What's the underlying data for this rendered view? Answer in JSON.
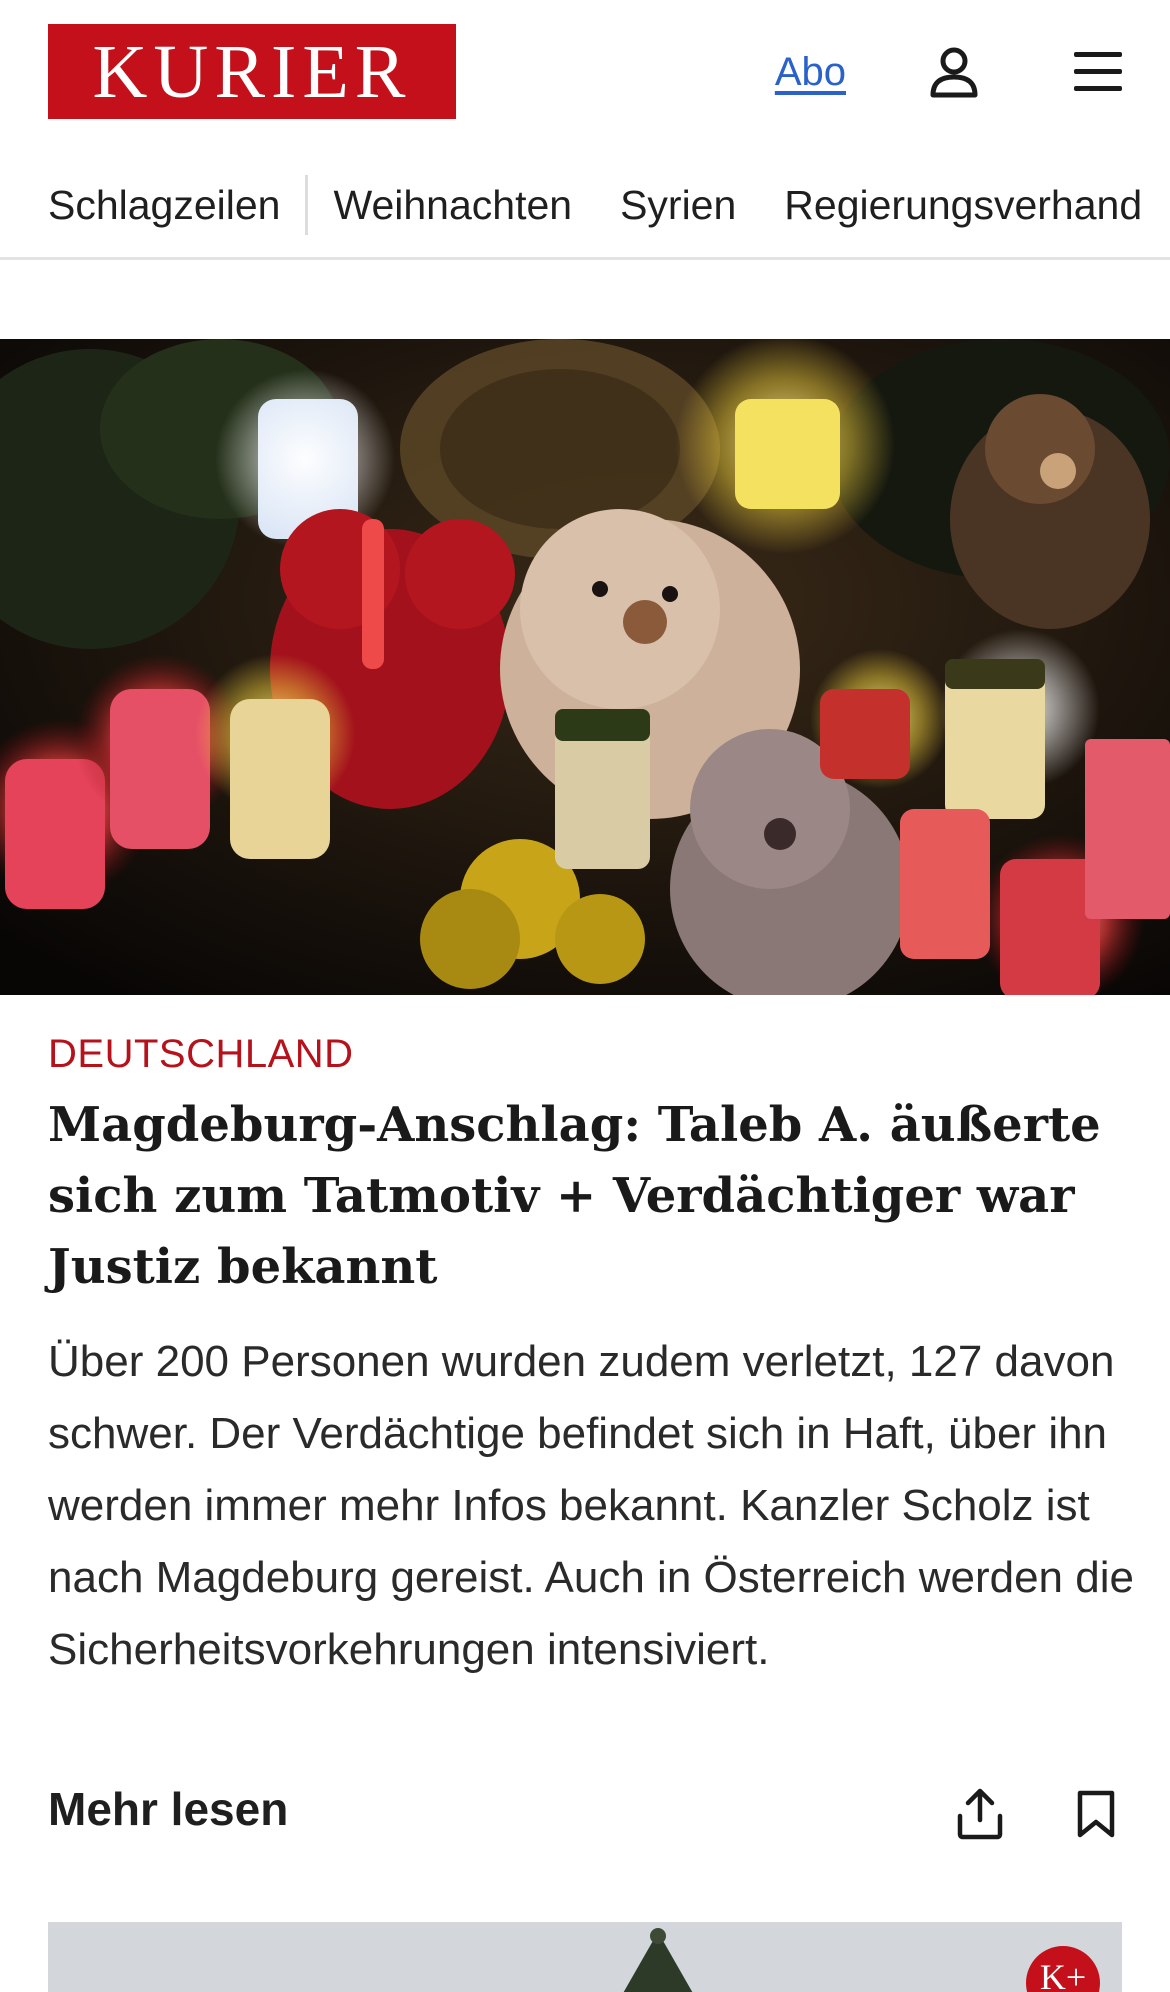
{
  "header": {
    "logo_text": "KURIER",
    "abo_label": "Abo",
    "brand_color": "#c4101a",
    "link_color": "#2a62c9"
  },
  "nav": {
    "items": [
      "Schlagzeilen",
      "Weihnachten",
      "Syrien",
      "Regierungsverhand"
    ]
  },
  "article": {
    "kicker": "DEUTSCHLAND",
    "headline": "Magdeburg-Anschlag: Taleb A. äußerte sich zum Tatmotiv + Verdächtiger war Justiz bekannt",
    "teaser": "Über 200 Personen wurden zudem verletzt, 127 davon schwer. Der Verdächtige befindet sich in Haft, über ihn werden immer mehr Infos bekannt. Kanzler Scholz ist nach Magdeburg gereist. Auch in Österreich werden die Sicherheitsvorkehrungen intensiviert.",
    "more_label": "Mehr lesen",
    "kicker_color": "#b5121b"
  },
  "next_card": {
    "badge": "K+"
  },
  "icons": {
    "user": "user-icon",
    "menu": "hamburger-menu-icon",
    "share": "share-icon",
    "bookmark": "bookmark-icon"
  }
}
